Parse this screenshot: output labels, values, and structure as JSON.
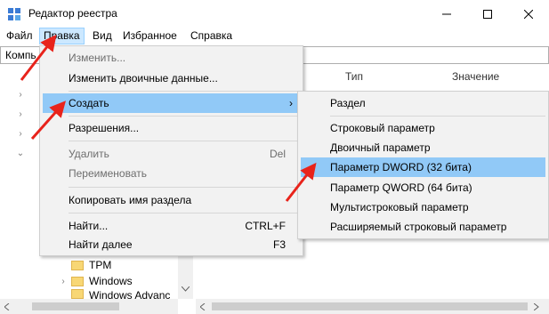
{
  "window": {
    "title": "Редактор реестра"
  },
  "menubar": {
    "file": "Файл",
    "edit": "Правка",
    "view": "Вид",
    "favorites": "Избранное",
    "help": "Справка"
  },
  "address": {
    "value": "Компь"
  },
  "columns": {
    "type": "Тип",
    "value": "Значение"
  },
  "tree": {
    "items": [
      {
        "label": "TPM"
      },
      {
        "label": "Windows"
      },
      {
        "label": "Windows Advanc"
      }
    ]
  },
  "edit_menu": {
    "modify": "Изменить...",
    "modify_binary": "Изменить двоичные данные...",
    "new": "Создать",
    "permissions": "Разрешения...",
    "delete": "Удалить",
    "delete_shortcut": "Del",
    "rename": "Переименовать",
    "copy_key": "Копировать имя раздела",
    "find": "Найти...",
    "find_shortcut": "CTRL+F",
    "find_next": "Найти далее",
    "find_next_shortcut": "F3"
  },
  "new_submenu": {
    "key": "Раздел",
    "string": "Строковый параметр",
    "binary": "Двоичный параметр",
    "dword": "Параметр DWORD (32 бита)",
    "qword": "Параметр QWORD (64 бита)",
    "multi_string": "Мультистроковый параметр",
    "expandable": "Расширяемый строковый параметр"
  },
  "colors": {
    "highlight": "#91c9f7",
    "menu_bg": "#f2f2f2",
    "annotation_arrow": "#e8231b"
  }
}
